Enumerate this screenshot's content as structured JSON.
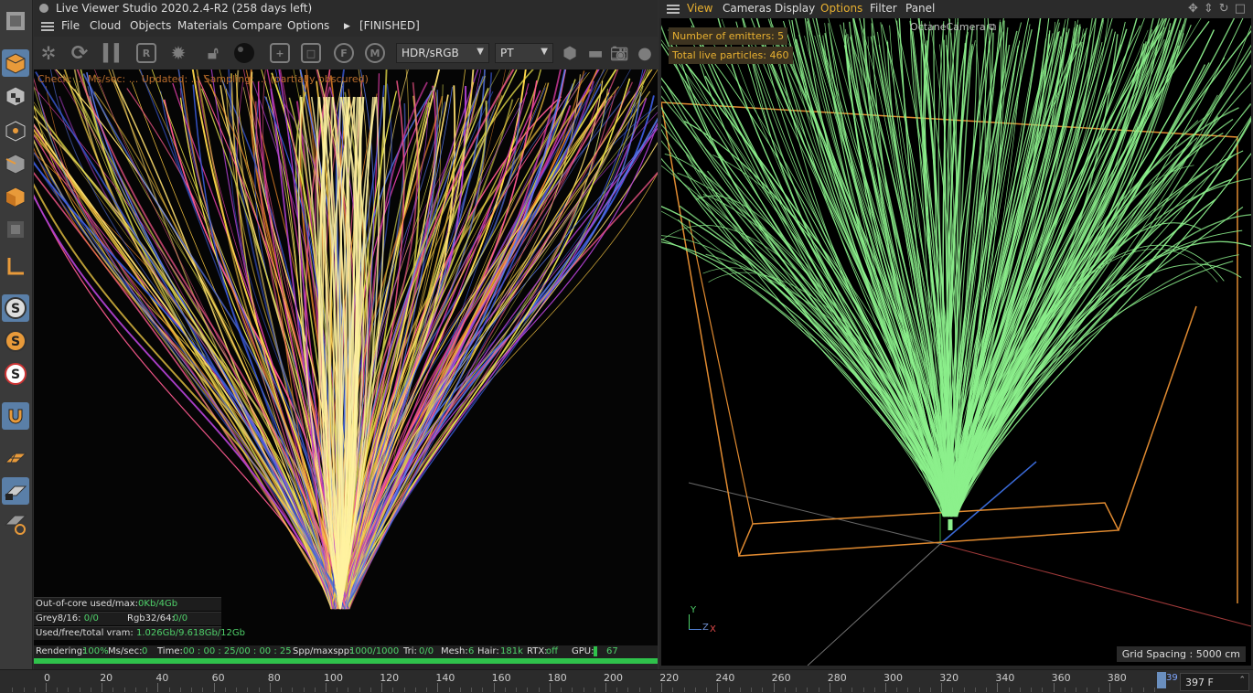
{
  "live_viewer": {
    "title": "Live Viewer Studio 2020.2.4-R2 (258 days left)",
    "menu": [
      "File",
      "Cloud",
      "Objects",
      "Materials",
      "Compare",
      "Options"
    ],
    "status_flag": "[FINISHED]",
    "tonemap_select": "HDR/sRGB",
    "kernel_select": "PT",
    "render_status_text": "Check: ... Ms/sec: ... Updated: ... Sampling: ... (partially obscured)",
    "stats": {
      "out_of_core_label": "Out-of-core used/max:",
      "out_of_core_value": "0Kb/4Gb",
      "grey_label": "Grey8/16:",
      "grey_value": "0/0",
      "rgb_label": "Rgb32/64:",
      "rgb_value": "0/0",
      "vram_label": "Used/free/total vram:",
      "vram_value": "1.026Gb/9.618Gb/12Gb"
    },
    "status_bar": {
      "rendering_label": "Rendering:",
      "rendering_value": "100%",
      "mssec_label": "Ms/sec:",
      "mssec_value": "0",
      "time_label": "Time:",
      "time_value": "00 : 00 : 25/00 : 00 : 25",
      "spp_label": "Spp/maxspp:",
      "spp_value": "1000/1000",
      "tri_label": "Tri:",
      "tri_value": "0/0",
      "mesh_label": "Mesh:",
      "mesh_value": "6",
      "hair_label": "Hair:",
      "hair_value": "181k",
      "rtx_label": "RTX:",
      "rtx_value": "off",
      "gpu_label": "GPU:",
      "gpu_value": "67"
    },
    "progress": 1.0
  },
  "viewport": {
    "menu": [
      "View",
      "Cameras",
      "Display",
      "Options",
      "Filter",
      "Panel"
    ],
    "active_menu": "Options",
    "camera_label": "OctaneCamera",
    "hud_emitters": "Number of emitters: 5",
    "hud_particles": "Total live particles: 460",
    "grid_spacing": "Grid Spacing : 5000 cm",
    "axis_y": "Y",
    "axis_z": "Z",
    "axis_x": "X"
  },
  "timeline": {
    "labels": [
      "0",
      "20",
      "40",
      "60",
      "80",
      "100",
      "120",
      "140",
      "160",
      "180",
      "200",
      "220",
      "240",
      "260",
      "280",
      "300",
      "320",
      "340",
      "360",
      "380"
    ],
    "current_frame_marker": "39",
    "end_frame": "397 F"
  },
  "colors": {
    "accent": "#5a7fa8",
    "hud_text": "#e8b030",
    "particle_green": "#8cf08c",
    "progress_green": "#2fc24b",
    "bbox_orange": "#e08a30"
  }
}
